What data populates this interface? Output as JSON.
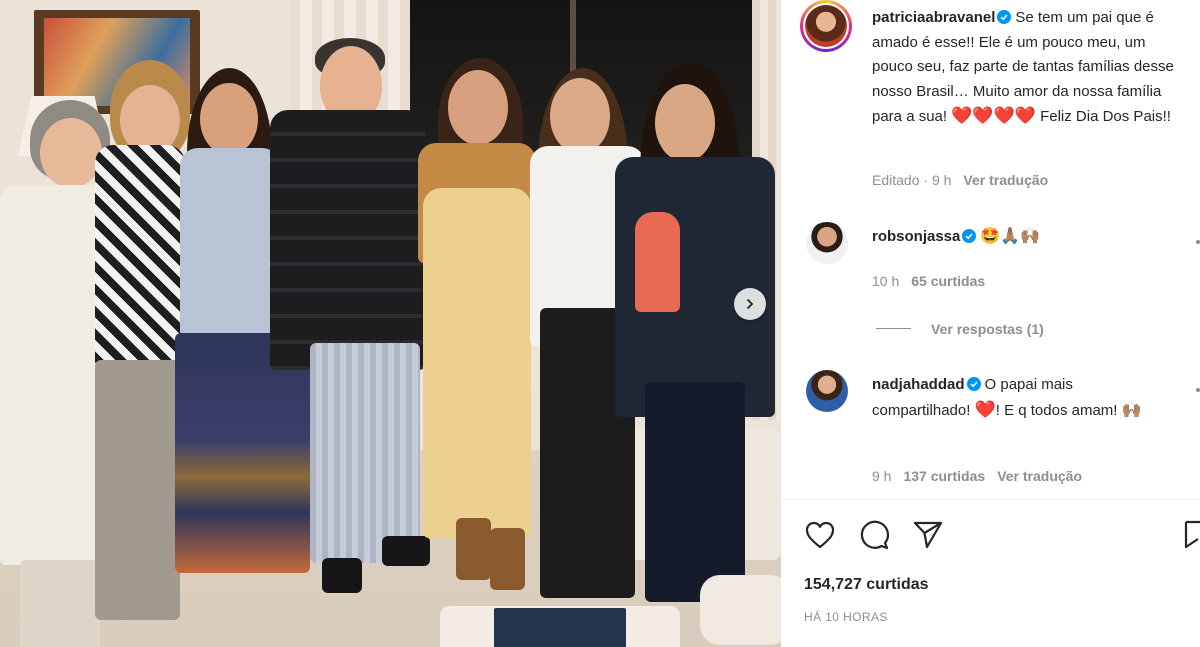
{
  "post": {
    "image_alt": "",
    "author": "patriciaabravanel",
    "caption": "Se tem um pai que é amado é esse!! Ele é um pouco meu, um pouco seu, faz parte de tantas famílias desse nosso Brasil… Muito amor da nossa família para a sua!",
    "caption_hearts": "❤️❤️❤️❤️",
    "caption_end": "Feliz Dia Dos Pais!!",
    "edited": "Editado",
    "edited_time": "9 h",
    "see_translation": "Ver tradução"
  },
  "comments": [
    {
      "user": "robsonjassa",
      "text": "",
      "emojis": "🤩🙏🏽🙌🏽",
      "time": "10 h",
      "likes": "65 curtidas",
      "replies": "Ver respostas (1)"
    },
    {
      "user": "nadjahaddad",
      "text_1": "O papai mais compartilhado!",
      "heart": "❤️",
      "text_2": "! E q todos amam!",
      "emoji_end": "🙌🏽",
      "time": "9 h",
      "likes": "137 curtidas",
      "see_translation": "Ver tradução"
    }
  ],
  "stats": {
    "likes": "154,727 curtidas",
    "posted": "HÁ 10 HORAS"
  },
  "icons": {
    "verified": "verified-badge-icon",
    "like": "heart-icon",
    "comment": "comment-icon",
    "share": "send-icon",
    "save": "bookmark-icon",
    "next": "chevron-right-icon"
  },
  "colors": {
    "verified": "#0095f6",
    "text": "#262626",
    "muted": "#8e8e8e"
  }
}
